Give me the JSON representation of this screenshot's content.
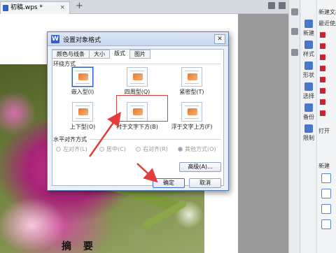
{
  "tabbar": {
    "doc_tab_label": "初稿.wps *",
    "close_glyph": "×",
    "new_tab_glyph": "+"
  },
  "document": {
    "heading": "摘 要"
  },
  "dialog": {
    "title": "设置对象格式",
    "close_glyph": "✕",
    "tabs": [
      "颜色与线条",
      "大小",
      "版式",
      "图片"
    ],
    "active_tab": "版式",
    "wrap_section_label": "环绕方式",
    "wrap_options": [
      "嵌入型(I)",
      "四周型(Q)",
      "紧密型(T)",
      "上下型(O)",
      "衬于文字下方(B)",
      "浮于文字上方(F)"
    ],
    "selected_wrap": "嵌入型(I)",
    "align_section_label": "水平对齐方式",
    "align_options": [
      "左对齐(L)",
      "居中(C)",
      "右对齐(R)",
      "其他方式(O)"
    ],
    "align_selected": "其他方式(O)",
    "advanced_button": "高级(A)...",
    "ok_button": "确定",
    "cancel_button": "取消"
  },
  "task_pane": {
    "header_text": "新建文档",
    "recent_label": "最近使用",
    "tools": [
      "新建",
      "样式",
      "形状",
      "选择",
      "备份",
      "限制"
    ],
    "new_section_label": "新建",
    "open_label": "打开"
  },
  "icons": [
    "document-icon",
    "app-icon",
    "new-icon",
    "style-icon",
    "shape-icon",
    "select-icon",
    "backup-icon",
    "restrict-icon"
  ],
  "colors": {
    "highlight_red": "#e23c3c",
    "dialog_blue": "#2f62c7",
    "wrap_icon_orange": "#e57a2b"
  }
}
